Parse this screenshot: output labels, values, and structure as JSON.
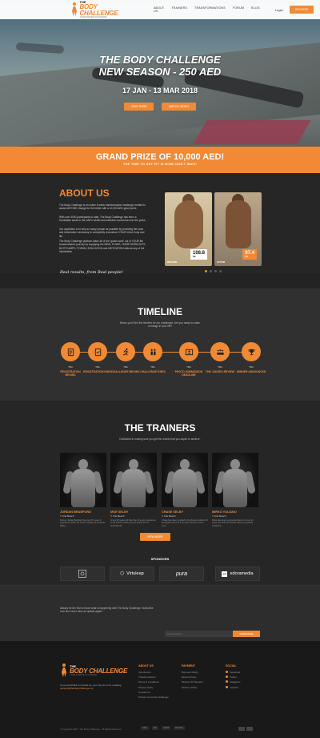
{
  "nav": {
    "logo": {
      "line1": "THE",
      "line2": "BODY CHALLENGE",
      "line3": "YOUR CHANCE TO CHANGE"
    },
    "links": [
      "ABOUT US",
      "TRAINERS",
      "TRANSFORMATIONS",
      "FORUM",
      "BLOG"
    ],
    "login": "Login",
    "register": "REGISTER"
  },
  "hero": {
    "title_line1": "THE BODY CHALLENGE",
    "title_line2": "NEW SEASON - 250 AED",
    "dates": "17 JAN - 13 MAR 2018",
    "btn_join": "JOIN THEM",
    "btn_video": "WATCH VIDEO"
  },
  "prize": {
    "title": "GRAND PRIZE OF 10,000 AED!",
    "subtitle": "THE TIME TO GET FIT IS NOW! DON'T WAIT!"
  },
  "about": {
    "heading": "ABOUT US",
    "p1": "The Body Challenge is an online 8 week transformation challenge created to assist ANYONE change for the better with a 10,000 AED grand prize.",
    "p2": "With over 4000 participants to date, The Body Challenge has been a formidable asset to the UAE's health and wellness movement over the years.",
    "p3": "Our aspiration is to help as many people as possible by providing the tools and information necessary to completely reconstruct YOUR mind, body and life.",
    "p4": "The Body Challenge platform takes all of the 'guess work' out of YOUR life transformation journey by supplying the MEAL PLANS, HOME WORKOUTS, BOOTCAMPS, FORUM, EDUCATION and MOTIVATION without any of the intimidation.",
    "signature": "Real results, from Real people!",
    "before": {
      "label": "BEFORE",
      "value": "108.8",
      "unit": "KG"
    },
    "after": {
      "label": "AFTER",
      "value": "97.4",
      "unit": "KG"
    },
    "carousel_active": 1
  },
  "timeline": {
    "heading": "TIMELINE",
    "subtitle": "Below you'll find the timeline for our challenges. Are you ready to make a change in your life?",
    "items": [
      {
        "tba": "TBA",
        "label": "REGISTRATION BEGINS",
        "icon": "clipboard-icon"
      },
      {
        "tba": "TBA",
        "label": "REGISTRATION ENDS",
        "icon": "clipboard-check-icon"
      },
      {
        "tba": "TBA",
        "label": "CHALLENGE BEGINS",
        "icon": "runner-icon"
      },
      {
        "tba": "TBA",
        "label": "CHALLENGE ENDS",
        "icon": "people-icon"
      },
      {
        "tba": "TBA",
        "label": "PHOTO SUBMISSION DEADLINE",
        "icon": "photo-icon"
      },
      {
        "tba": "TBA",
        "label": "THE JUDGES REVIEW",
        "icon": "judges-icon"
      },
      {
        "tba": "TBA",
        "label": "WINNER ANNOUNCED",
        "icon": "trophy-icon"
      }
    ]
  },
  "trainers": {
    "heading": "THE TRAINERS",
    "subtitle": "Dedicated to making sure you get the results that you aspire to achieve.",
    "list": [
      {
        "name": "JORDAN BRANFORD",
        "club": "Kite Beach",
        "bio": "Former Jordan Branford has over 15 years of experience within the fitness industry and has the ability..."
      },
      {
        "name": "MOE SELBY",
        "club": "Kite Beach",
        "bio": "At just 28 years old Moe has 10 years experience in the fitness industry and is known for his motivational..."
      },
      {
        "name": "CHASE SELBY",
        "club": "Kite Beach",
        "bio": "Chase has been involved in the fitness industry for an equal amount of time and is known to be a very..."
      },
      {
        "name": "MIRKO YULIANO",
        "club": "Kite Beach",
        "bio": "Mirko has been a personal trainer for over 10 years and uses his studies above everything except his..."
      }
    ],
    "view_more": "VIEW MORE",
    "sponsors_heading": "SPONSORS",
    "sponsors": [
      "",
      "Virtuleap",
      "pura",
      "edoramedia"
    ]
  },
  "newsletter": {
    "text": "Always be the first to know what is happening with The Body Challenge. Subscribe now and never miss an update again!",
    "placeholder": "Email Address",
    "button": "SUBSCRIBE"
  },
  "footer": {
    "desc_pre": "If you would like to contact us, you may do so by emailing",
    "email": "support@thebodychallenge.me",
    "col1": {
      "heading": "ABOUT US",
      "links": [
        "Introduction",
        "Transformations",
        "Terms & Conditions",
        "Privacy Policy",
        "Contact Us",
        "Private Corporate Challenge"
      ]
    },
    "col2": {
      "heading": "PAYMENT",
      "links": [
        "Payment Policy",
        "Refund Policy",
        "Method Of Payment",
        "Delivery Policy"
      ]
    },
    "col3": {
      "heading": "SOCIAL",
      "links": [
        "Facebook",
        "Twitter",
        "Instagram",
        "Youtube"
      ]
    },
    "copyright": "© Copyright 2018 · The Body Challenge · All Rights Reserved",
    "payments": [
      "VISA",
      "MC",
      "AMEX",
      "PAYPAL"
    ]
  },
  "colors": {
    "accent": "#f08a35",
    "dark": "#232323"
  }
}
